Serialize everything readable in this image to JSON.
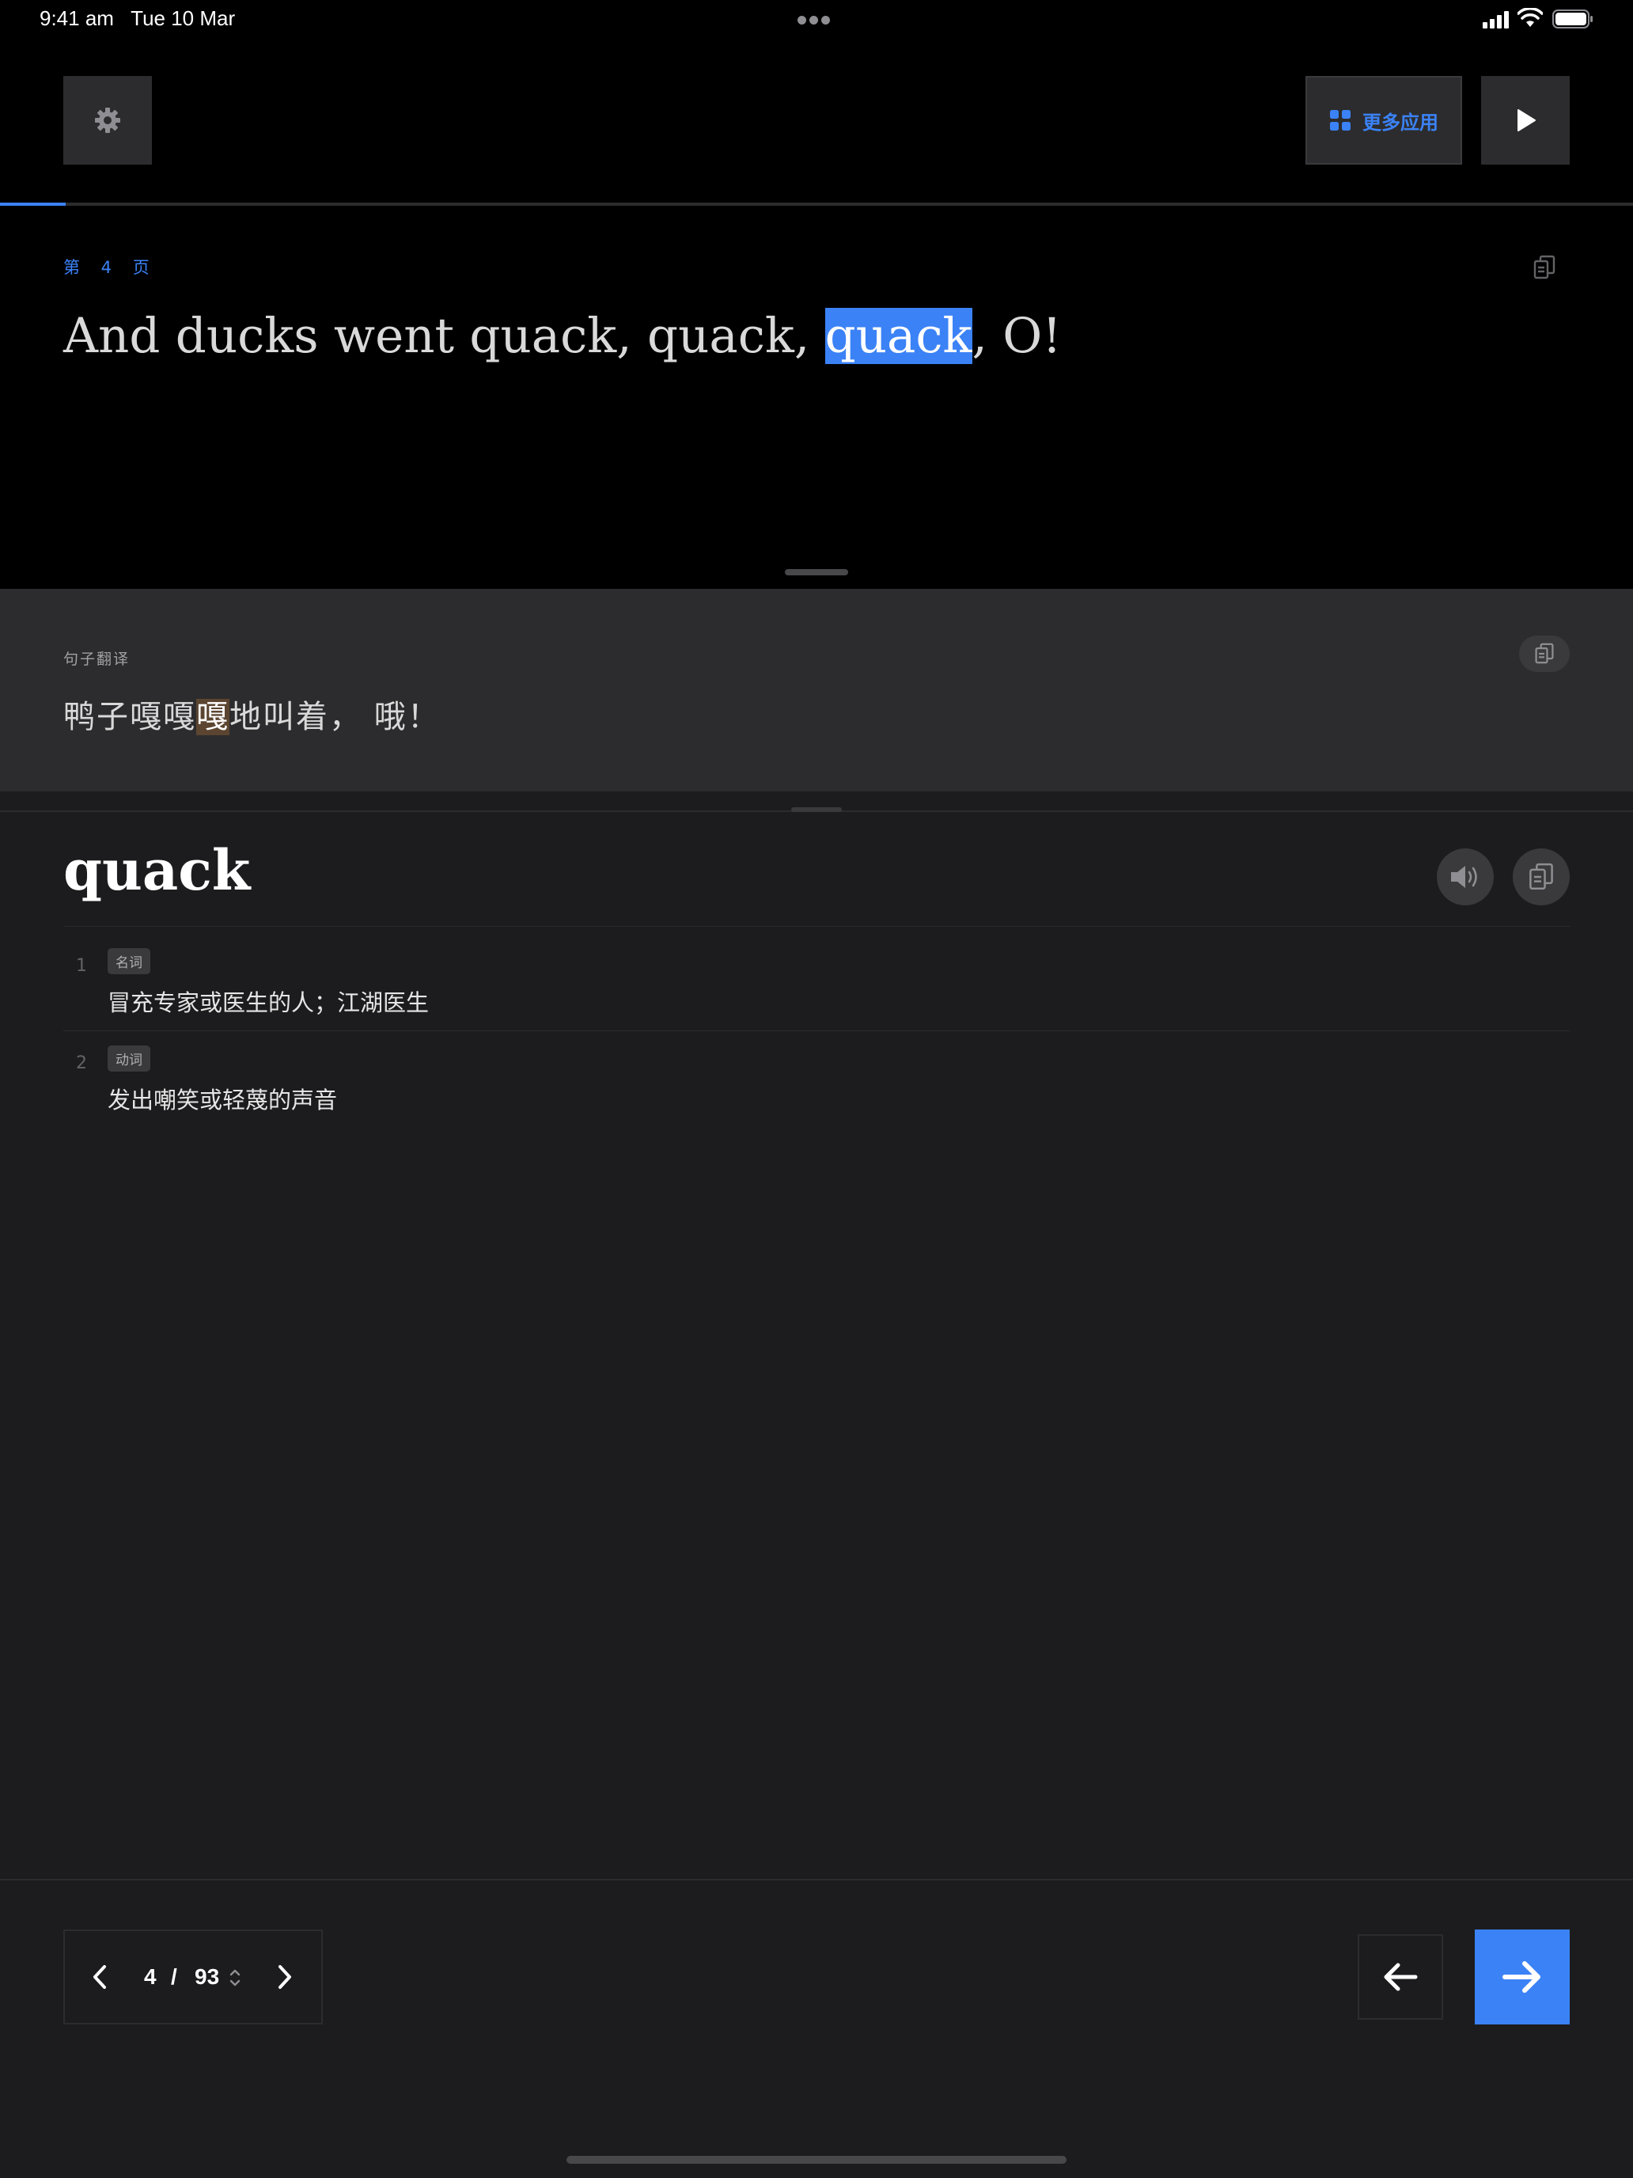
{
  "status_bar": {
    "time_date": "9:41 am   Tue 10 Mar"
  },
  "toolbar": {
    "more_apps_label": "更多应用"
  },
  "reading_progress": 0.04,
  "reader": {
    "page_label": "第 4 页",
    "sentence_before": "And ducks went quack, quack, ",
    "sentence_highlight": "quack",
    "sentence_after": ", O!"
  },
  "translation": {
    "label": "句子翻译",
    "text_before": "鸭子嘎嘎",
    "text_highlight": "嘎",
    "text_after": "地叫着， 哦！"
  },
  "word": {
    "headword": "quack",
    "definitions": [
      {
        "number": "1",
        "pos": "名词",
        "text": "冒充专家或医生的人；江湖医生"
      },
      {
        "number": "2",
        "pos": "动词",
        "text": "发出嘲笑或轻蔑的声音"
      }
    ]
  },
  "pager": {
    "current": "4",
    "separator": "/",
    "total": "93"
  },
  "colors": {
    "accent": "#3b82f6",
    "background": "#1c1c1e",
    "top_pane": "#000000",
    "translation_highlight": "#5b4530"
  },
  "icons": {
    "settings": "gear-icon",
    "more_apps": "grid-icon",
    "play": "play-icon",
    "copy": "copy-icon",
    "speaker": "speaker-icon",
    "prev_page": "chevron-left-icon",
    "next_page": "chevron-right-icon",
    "back": "arrow-left-icon",
    "forward": "arrow-right-icon"
  }
}
